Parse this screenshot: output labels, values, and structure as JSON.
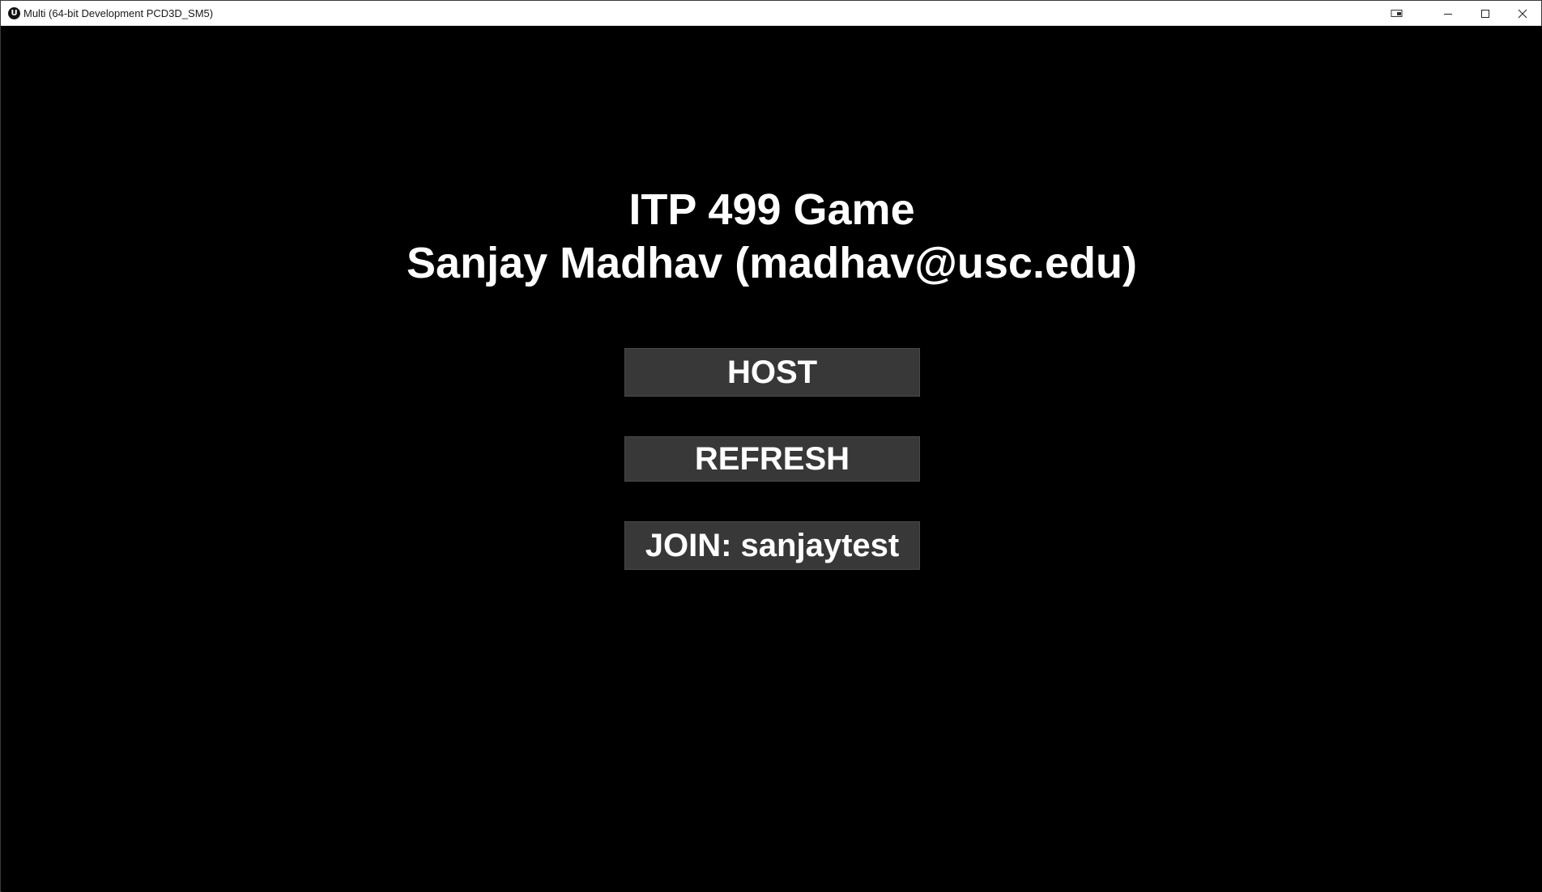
{
  "window": {
    "title": "Multi (64-bit Development PCD3D_SM5)",
    "app_icon_glyph": "U",
    "controls": {
      "gamebar_icon": "gamebar-icon",
      "minimize_icon": "minimize-icon",
      "maximize_icon": "maximize-icon",
      "close_icon": "close-icon"
    }
  },
  "menu": {
    "title_line1": "ITP 499 Game",
    "title_line2": "Sanjay Madhav (madhav@usc.edu)",
    "buttons": {
      "host_label": "HOST",
      "refresh_label": "REFRESH",
      "join_label": "JOIN: sanjaytest"
    }
  },
  "colors": {
    "background": "#000000",
    "button_bg": "#383838",
    "text": "#ffffff"
  }
}
